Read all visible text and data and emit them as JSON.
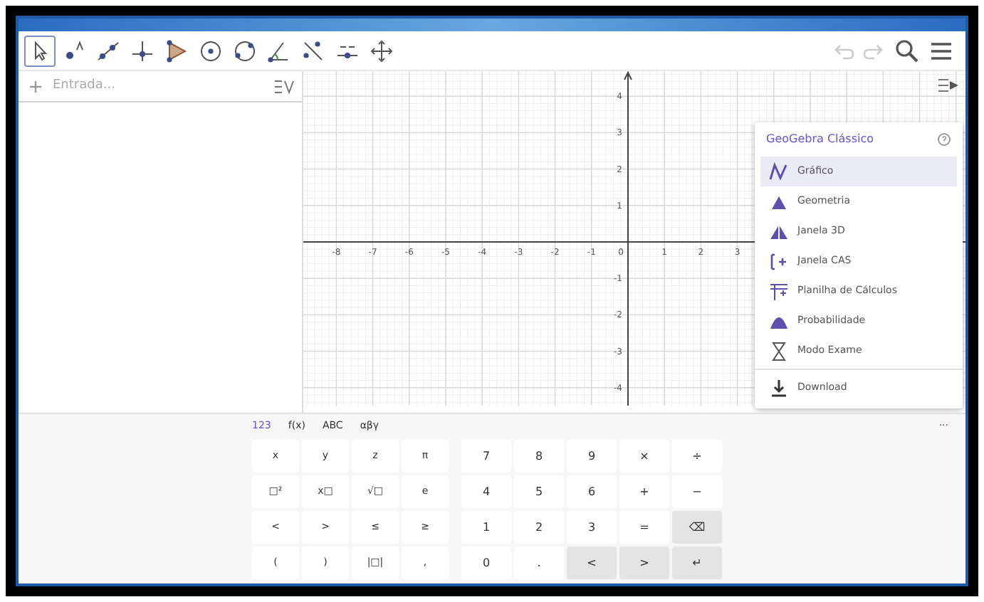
{
  "toolbar": {
    "tools": [
      {
        "kind": "move",
        "selected": true
      },
      {
        "kind": "point",
        "selected": false
      },
      {
        "kind": "line",
        "selected": false
      },
      {
        "kind": "perpendicular",
        "selected": false
      },
      {
        "kind": "polygon",
        "selected": false
      },
      {
        "kind": "circle",
        "selected": false
      },
      {
        "kind": "circle3",
        "selected": false
      },
      {
        "kind": "angle",
        "selected": false
      },
      {
        "kind": "reflect",
        "selected": false
      },
      {
        "kind": "slider",
        "selected": false
      },
      {
        "kind": "pan",
        "selected": false
      }
    ]
  },
  "algebra": {
    "input": {
      "placeholder": "Entrada..."
    }
  },
  "graphics": {
    "x_labels": [
      "-8",
      "-7",
      "-6",
      "-5",
      "-4",
      "-3",
      "-2",
      "-1",
      "0",
      "1",
      "2",
      "3"
    ],
    "y_labels": [
      "4",
      "3",
      "2",
      "1",
      "-1",
      "-2",
      "-3",
      "-4"
    ]
  },
  "menu": {
    "title": "GeoGebra Clássico",
    "items": [
      {
        "kind": "graph",
        "label": "Gráfico",
        "selected": true
      },
      {
        "kind": "geometry",
        "label": "Geometria",
        "selected": false
      },
      {
        "kind": "window3d",
        "label": "Janela 3D",
        "selected": false
      },
      {
        "kind": "cas",
        "label": "Janela CAS",
        "selected": false
      },
      {
        "kind": "spreadsheet",
        "label": "Planilha de Cálculos",
        "selected": false
      },
      {
        "kind": "probability",
        "label": "Probabilidade",
        "selected": false
      },
      {
        "kind": "exam",
        "label": "Modo Exame",
        "selected": false
      },
      {
        "kind": "download",
        "label": "Download",
        "selected": false
      }
    ]
  },
  "keyboard": {
    "tabs": [
      {
        "label": "123",
        "selected": true
      },
      {
        "label": "f(x)",
        "selected": false
      },
      {
        "label": "ABC",
        "selected": false
      },
      {
        "label": "αβγ",
        "selected": false
      }
    ],
    "more": "···",
    "left_keys": [
      [
        "x",
        "y",
        "z",
        "π"
      ],
      [
        "□²",
        "x□",
        "√□",
        "e"
      ],
      [
        "<",
        ">",
        "≤",
        "≥"
      ],
      [
        "(",
        ")",
        "|□|",
        ","
      ]
    ],
    "right_keys": [
      [
        {
          "label": "7",
          "kind": "key"
        },
        {
          "label": "8",
          "kind": "key"
        },
        {
          "label": "9",
          "kind": "key"
        },
        {
          "label": "×",
          "kind": "key"
        },
        {
          "label": "÷",
          "kind": "key"
        }
      ],
      [
        {
          "label": "4",
          "kind": "key"
        },
        {
          "label": "5",
          "kind": "key"
        },
        {
          "label": "6",
          "kind": "key"
        },
        {
          "label": "+",
          "kind": "key"
        },
        {
          "label": "−",
          "kind": "key"
        }
      ],
      [
        {
          "label": "1",
          "kind": "key"
        },
        {
          "label": "2",
          "kind": "key"
        },
        {
          "label": "3",
          "kind": "key"
        },
        {
          "label": "=",
          "kind": "key"
        },
        {
          "label": "⌫",
          "kind": "action"
        }
      ],
      [
        {
          "label": "0",
          "kind": "key"
        },
        {
          "label": ".",
          "kind": "key"
        },
        {
          "label": "<",
          "kind": "action"
        },
        {
          "label": ">",
          "kind": "action"
        },
        {
          "label": "↵",
          "kind": "action"
        }
      ]
    ]
  }
}
